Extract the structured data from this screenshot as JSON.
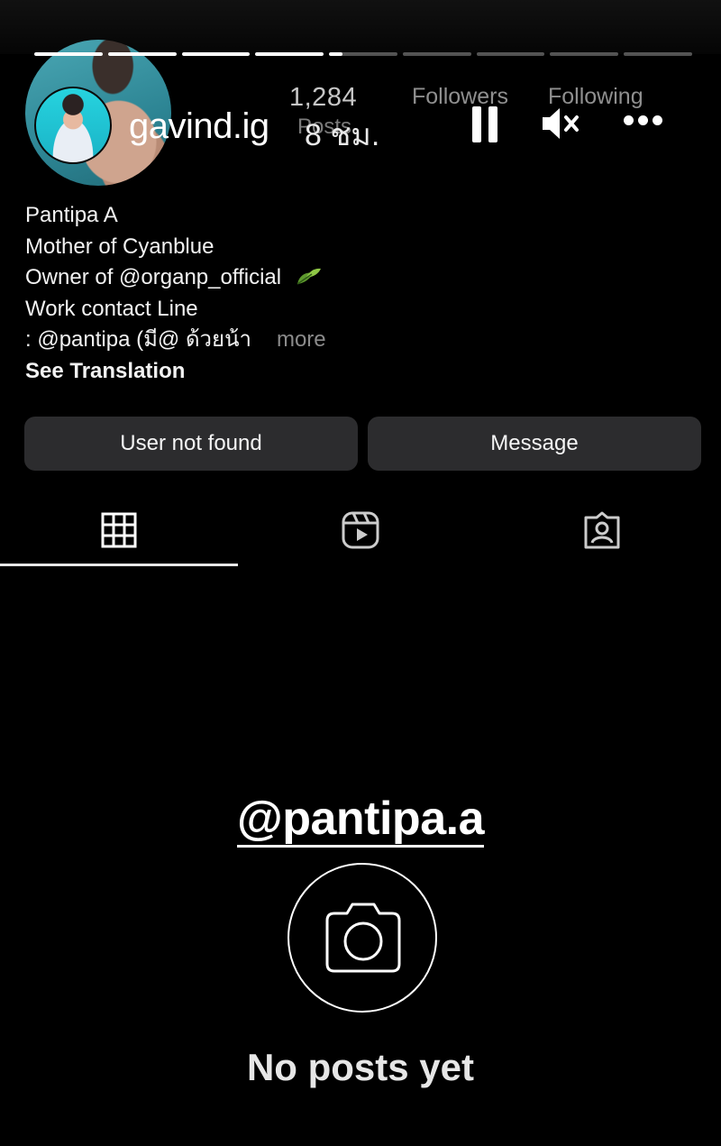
{
  "story": {
    "username": "gavind.ig",
    "time_ago": "8 ชม.",
    "progress": [
      1,
      1,
      1,
      1,
      0.2,
      0,
      0,
      0,
      0
    ]
  },
  "profile": {
    "posts_count": "1,284",
    "posts_label": "Posts",
    "followers_label": "Followers",
    "following_label": "Following",
    "name": "Pantipa A",
    "bio_lines": [
      "Mother of Cyanblue",
      "Owner of @organp_official",
      "Work contact Line",
      ": @pantipa (มี@ ด้วยน้า"
    ],
    "more_label": "more",
    "see_translation": "See Translation"
  },
  "buttons": {
    "user_not_found": "User not found",
    "message": "Message"
  },
  "tabs": [
    {
      "icon": "grid-icon",
      "active": true
    },
    {
      "icon": "reels-icon",
      "active": false
    },
    {
      "icon": "tagged-icon",
      "active": false
    }
  ],
  "overlay": {
    "handle": "@pantipa.a"
  },
  "empty_state": {
    "text": "No posts yet"
  }
}
